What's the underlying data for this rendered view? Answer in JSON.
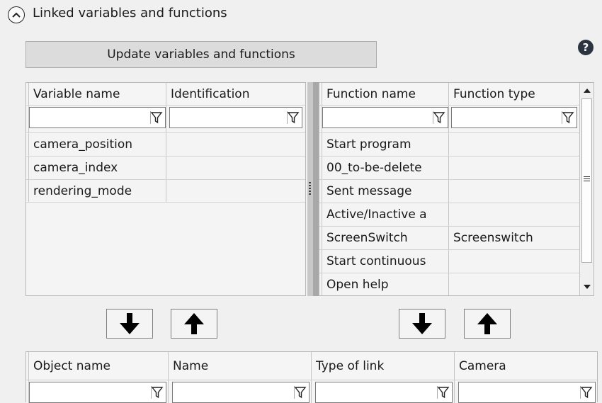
{
  "header": {
    "title": "Linked variables and functions"
  },
  "update_button": {
    "label": "Update variables and functions"
  },
  "variables_grid": {
    "columns": [
      "Variable name",
      "Identification"
    ],
    "rows": [
      [
        "camera_position",
        ""
      ],
      [
        "camera_index",
        ""
      ],
      [
        "rendering_mode",
        ""
      ]
    ]
  },
  "functions_grid": {
    "columns": [
      "Function name",
      "Function type"
    ],
    "rows": [
      [
        "Start program",
        ""
      ],
      [
        "00_to-be-delete",
        ""
      ],
      [
        "Sent message",
        ""
      ],
      [
        "Active/Inactive a",
        ""
      ],
      [
        "ScreenSwitch",
        "Screenswitch"
      ],
      [
        "Start continuous",
        ""
      ],
      [
        "Open help",
        ""
      ]
    ]
  },
  "links_grid": {
    "columns": [
      "Object name",
      "Name",
      "Type of link",
      "Camera"
    ]
  },
  "icons": {
    "help": "help-circle-icon",
    "collapse": "chevron-up-icon",
    "filter": "filter-funnel-icon",
    "move_down": "arrow-down-icon",
    "move_up": "arrow-up-icon"
  }
}
